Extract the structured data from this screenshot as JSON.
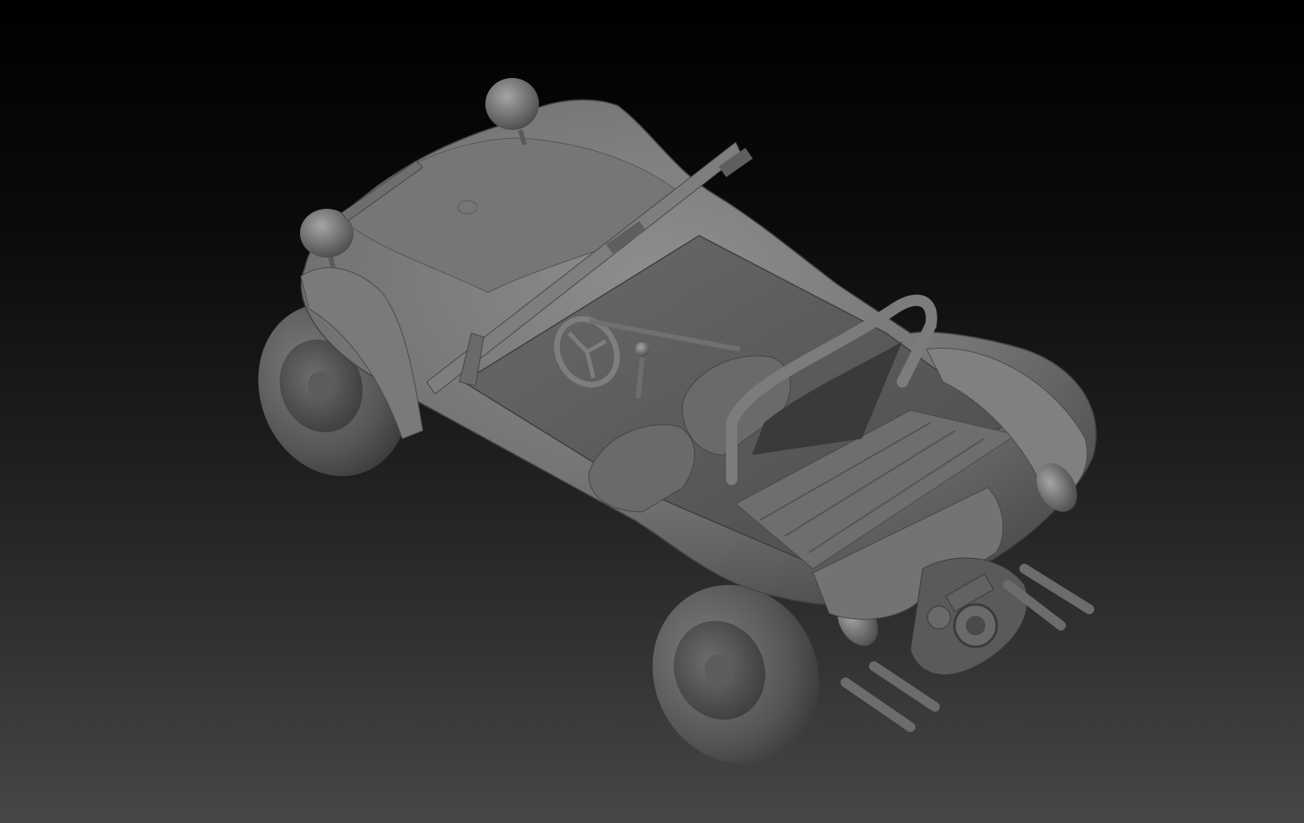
{
  "viewport": {
    "background_top": "#000000",
    "background_bottom": "#474747",
    "material_color": "#7a7a7a"
  },
  "model": {
    "type": "dune buggy clay render"
  }
}
